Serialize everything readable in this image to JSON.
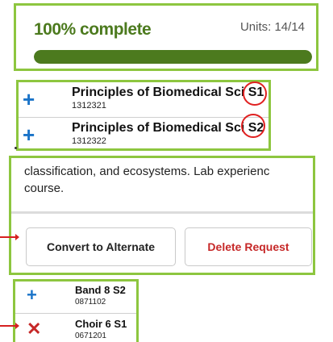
{
  "progress": {
    "label": "100% complete",
    "units": "Units: 14/14",
    "fraction": 1.0,
    "bar_color": "#4c7a1e"
  },
  "courses": [
    {
      "name": "Principles of Biomedical Sci",
      "term": "S1",
      "code": "1312321",
      "icon": "plus-icon"
    },
    {
      "name": "Principles of Biomedical Sci",
      "term": "S2",
      "code": "1312322",
      "icon": "plus-icon"
    }
  ],
  "description": {
    "line1": "classification, and ecosystems. Lab experienc",
    "line2": "course."
  },
  "buttons": {
    "convert": "Convert to Alternate",
    "delete": "Delete Request"
  },
  "bottom_courses": [
    {
      "name": "Band 8 S2",
      "code": "0871102",
      "icon": "plus-icon"
    },
    {
      "name": "Choir 6 S1",
      "code": "0671201",
      "icon": "close-icon"
    }
  ],
  "colors": {
    "panel_border": "#8dc63f",
    "accent_blue": "#1a73c8",
    "danger_red": "#c62828",
    "annotation_red": "#e02020"
  }
}
